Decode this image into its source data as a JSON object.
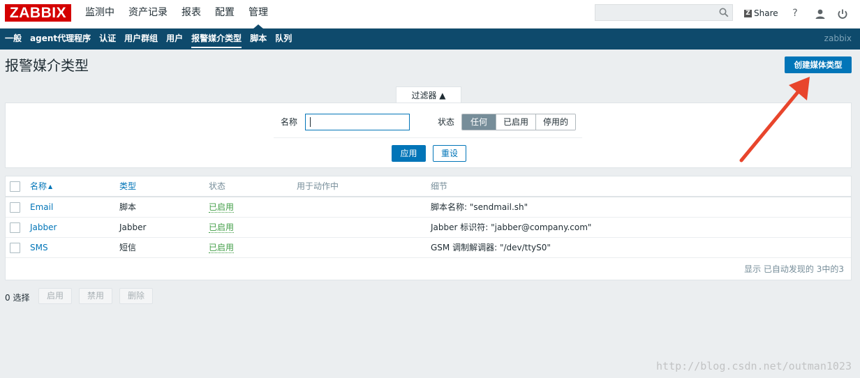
{
  "app": {
    "logo": "ZABBIX"
  },
  "main_menu": [
    {
      "label": "监测中"
    },
    {
      "label": "资产记录"
    },
    {
      "label": "报表"
    },
    {
      "label": "配置"
    },
    {
      "label": "管理",
      "active": true
    }
  ],
  "header_right": {
    "search_value": "",
    "share_label": "Share",
    "share_badge": "Z",
    "help_label": "?"
  },
  "sub_menu": [
    {
      "label": "一般"
    },
    {
      "label": "agent代理程序"
    },
    {
      "label": "认证"
    },
    {
      "label": "用户群组"
    },
    {
      "label": "用户"
    },
    {
      "label": "报警媒介类型",
      "active": true
    },
    {
      "label": "脚本"
    },
    {
      "label": "队列"
    }
  ],
  "server_name": "zabbix",
  "page": {
    "title": "报警媒介类型",
    "create_button": "创建媒体类型"
  },
  "filter": {
    "tab_label": "过滤器 ▲",
    "name_label": "名称",
    "name_value": "",
    "status_label": "状态",
    "status_options": [
      "任何",
      "已启用",
      "停用的"
    ],
    "status_selected": "任何",
    "apply_label": "应用",
    "reset_label": "重设"
  },
  "table": {
    "columns": {
      "name": "名称",
      "name_sort": "▲",
      "type": "类型",
      "status": "状态",
      "used": "用于动作中",
      "details": "细节"
    },
    "rows": [
      {
        "name": "Email",
        "type": "脚本",
        "status": "已启用",
        "used": "",
        "details": "脚本名称: \"sendmail.sh\""
      },
      {
        "name": "Jabber",
        "type": "Jabber",
        "status": "已启用",
        "used": "",
        "details": "Jabber 标识符: \"jabber@company.com\""
      },
      {
        "name": "SMS",
        "type": "短信",
        "status": "已启用",
        "used": "",
        "details": "GSM 调制解调器: \"/dev/ttyS0\""
      }
    ],
    "footer": "显示 已自动发现的 3中的3"
  },
  "actions": {
    "selected": "0 选择",
    "enable": "启用",
    "disable": "禁用",
    "delete": "删除"
  },
  "colors": {
    "accent": "#0275b8",
    "nav": "#0e4a6c",
    "logo": "#d40000",
    "enabled": "#429e47",
    "annotation": "#e8452c"
  },
  "watermark": "http://blog.csdn.net/outman1023"
}
